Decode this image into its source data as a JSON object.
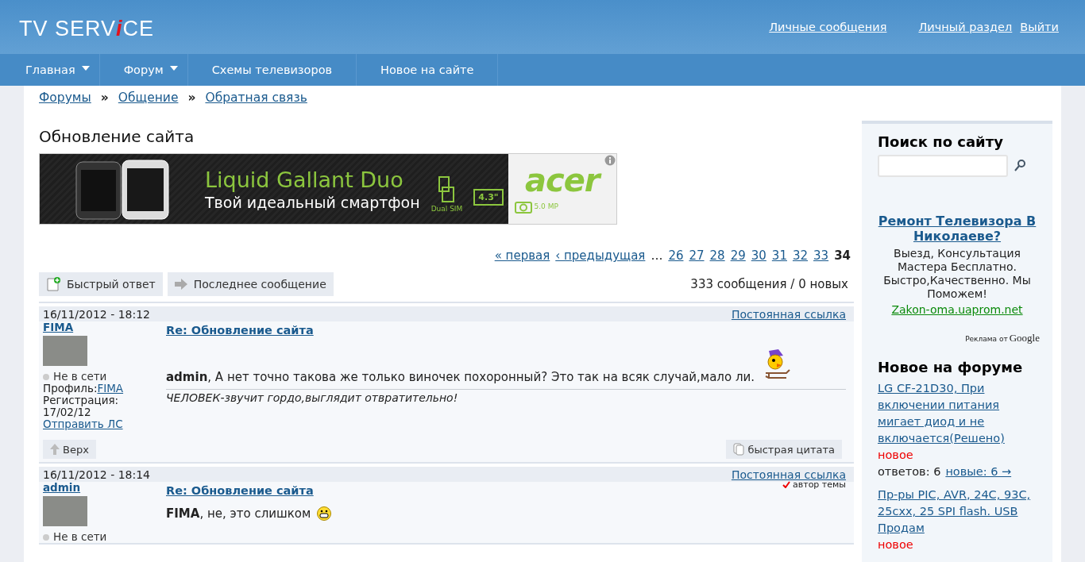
{
  "header": {
    "logo": {
      "start": "TV SERV",
      "accent": "i",
      "end": "CE"
    },
    "links": [
      "Личные сообщения",
      "Личный раздел",
      "Выйти"
    ]
  },
  "nav": [
    {
      "label": "Главная",
      "dropdown": true
    },
    {
      "label": "Форум",
      "dropdown": true
    },
    {
      "label": "Схемы телевизоров",
      "dropdown": false
    },
    {
      "label": "Новое на сайте",
      "dropdown": false
    }
  ],
  "breadcrumbs": [
    "Форумы",
    "Общение",
    "Обратная связь"
  ],
  "breadcrumb_separator": "»",
  "topic_title": "Обновление сайта",
  "banner": {
    "headline": "Liquid Gallant Duo",
    "tagline": "Твой идеальный смартфон",
    "sim_label": "Dual SIM",
    "screen_size": "4.3\"",
    "camera": "5.0 MP",
    "brand": "acer"
  },
  "pagination": [
    {
      "label": "« первая",
      "selected": false
    },
    {
      "label": "‹ предыдущая",
      "selected": false
    },
    {
      "label": "…",
      "kind": "gap",
      "selected": false
    },
    {
      "label": "26",
      "selected": false
    },
    {
      "label": "27",
      "selected": false
    },
    {
      "label": "28",
      "selected": false
    },
    {
      "label": "29",
      "selected": false
    },
    {
      "label": "30",
      "selected": false
    },
    {
      "label": "31",
      "selected": false
    },
    {
      "label": "32",
      "selected": false
    },
    {
      "label": "33",
      "selected": false
    },
    {
      "label": "34",
      "selected": true
    }
  ],
  "actions": [
    {
      "label": "Быстрый ответ",
      "kind": "reply"
    },
    {
      "label": "Последнее сообщение",
      "kind": "last"
    }
  ],
  "post_count": "333 сообщения / 0 новых",
  "posts": [
    {
      "date": "16/11/2012 - 18:12",
      "permalink": "Постоянная ссылка",
      "author": "FIMA",
      "status": "Не в сети",
      "online": false,
      "profile_label": "Профиль:",
      "profile_link": "FIMA",
      "registration": "Регистрация: 17/02/12",
      "send_pm": "Отправить ЛС",
      "title": "Re: Обновление сайта",
      "body": "**admin**, А нет точно такова же только виночек похоронный? Это так на всяк случай,мало ли.",
      "emoticon": {
        "kind": "sled"
      },
      "signature": "ЧЕЛОВЕК-звучит гордо,выглядит отвратительно!",
      "top_button": "Верх",
      "quote_button": "быстрая цитата"
    },
    {
      "date": "16/11/2012 - 18:14",
      "permalink": "Постоянная ссылка",
      "author": "admin",
      "author_badge": "автор темы",
      "status": "Не в сети",
      "online": false,
      "title": "Re: Обновление сайта",
      "body": "**FIMA**, не, это слишком",
      "emoticon": {
        "kind": "grin"
      }
    }
  ],
  "sidebar": {
    "search_title": "Поиск по сайту",
    "ad": {
      "title": "Ремонт Телевизора В Николаеве?",
      "text": "Выезд, Консультация Мастера Бесплатно. Быстро,Качественно. Мы Поможем!",
      "url": "Zakon-oma.uaprom.net",
      "attribution": "Реклама от",
      "brand": "Google"
    },
    "new_title": "Новое на форуме",
    "topics": [
      {
        "title": "LG CF-21D30, При включении питания мигает диод и не включается(Решено)",
        "new_label": "новое",
        "replies": "ответов: 6",
        "new_link": "новые: 6 →"
      },
      {
        "title": "Пр-ры PIC, AVR, 24C, 93C, 25cxx, 25 SPI flash. USB Продам",
        "new_label": "новое"
      }
    ]
  }
}
